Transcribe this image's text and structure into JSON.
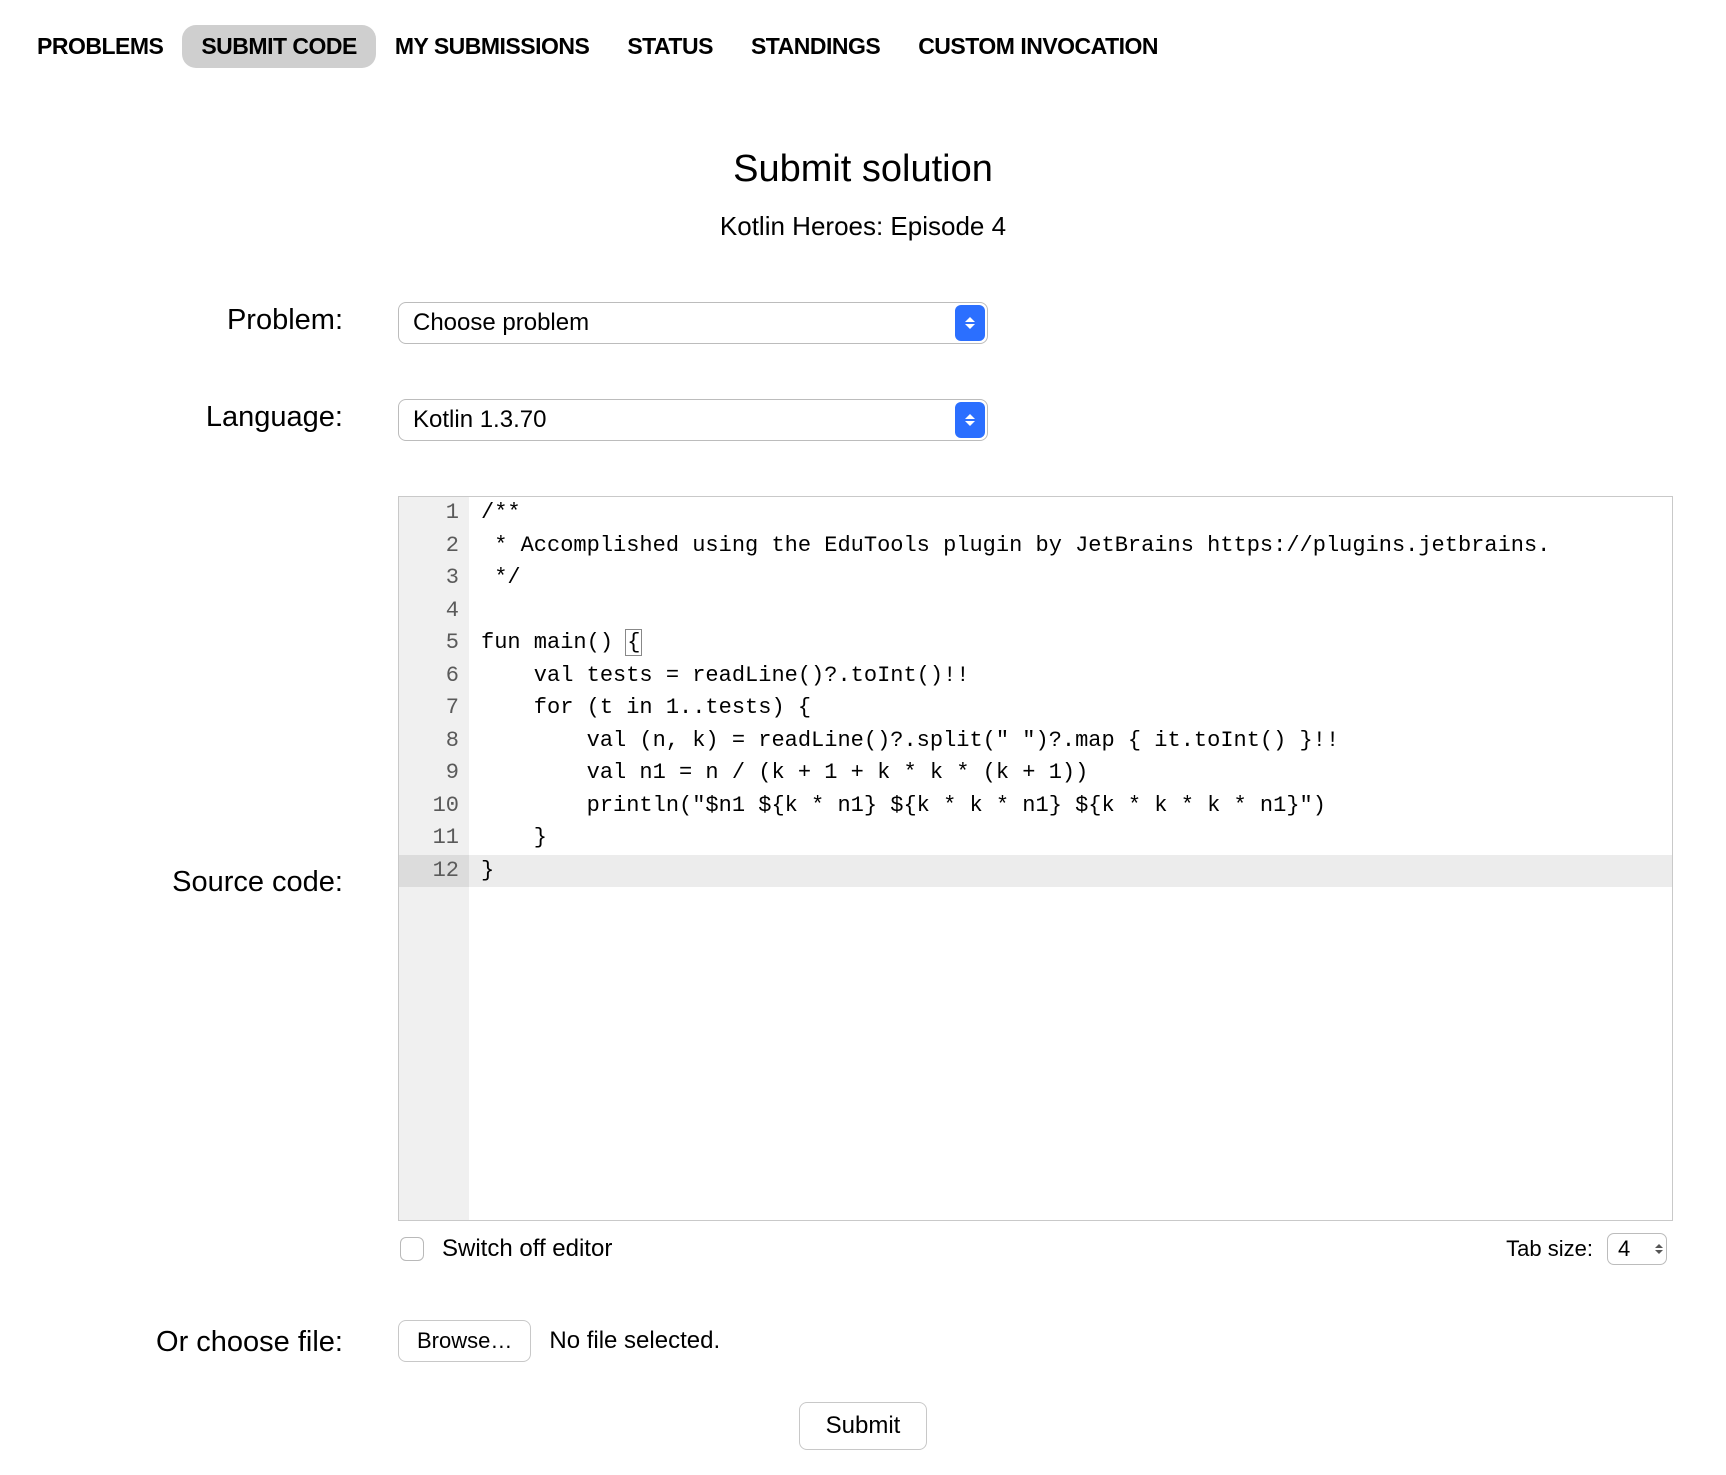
{
  "tabs": [
    {
      "label": "PROBLEMS",
      "active": false
    },
    {
      "label": "SUBMIT CODE",
      "active": true
    },
    {
      "label": "MY SUBMISSIONS",
      "active": false
    },
    {
      "label": "STATUS",
      "active": false
    },
    {
      "label": "STANDINGS",
      "active": false
    },
    {
      "label": "CUSTOM INVOCATION",
      "active": false
    }
  ],
  "heading": {
    "title": "Submit solution",
    "subtitle": "Kotlin Heroes: Episode 4"
  },
  "labels": {
    "problem": "Problem:",
    "language": "Language:",
    "source": "Source code:",
    "choose_file": "Or choose file:",
    "switch_off": "Switch off editor",
    "tab_size": "Tab size:",
    "browse": "Browse…",
    "no_file": "No file selected.",
    "submit": "Submit"
  },
  "selects": {
    "problem": "Choose problem",
    "language": "Kotlin 1.3.70"
  },
  "tab_size_value": "4",
  "code": {
    "highlight_line": 12,
    "lines": [
      "/**",
      " * Accomplished using the EduTools plugin by JetBrains https://plugins.jetbrains.",
      " */",
      "",
      "fun main() {",
      "    val tests = readLine()?.toInt()!!",
      "    for (t in 1..tests) {",
      "        val (n, k) = readLine()?.split(\" \")?.map { it.toInt() }!!",
      "        val n1 = n / (k + 1 + k * k * (k + 1))",
      "        println(\"$n1 ${k * n1} ${k * k * n1} ${k * k * k * n1}\")",
      "    }",
      "}"
    ]
  }
}
